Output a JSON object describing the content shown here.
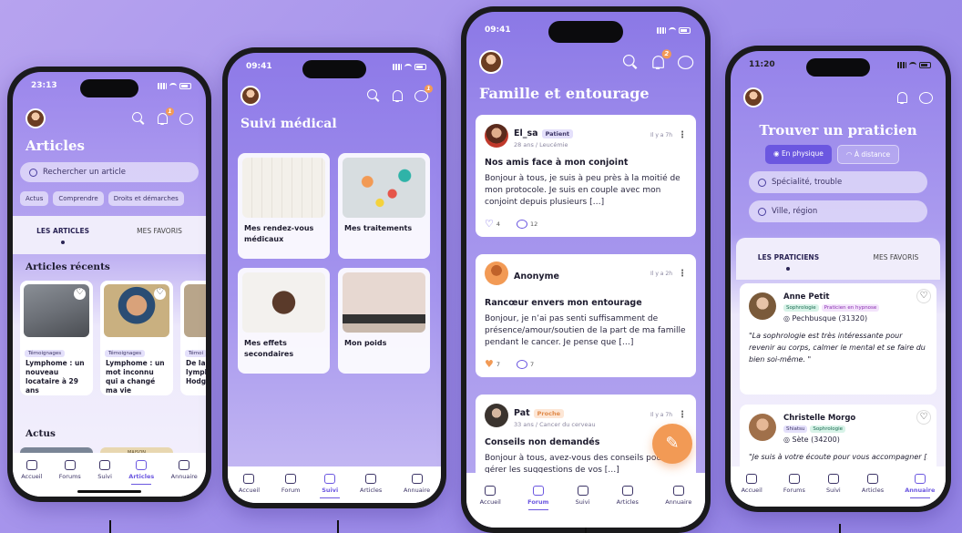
{
  "colors": {
    "accent": "#6b57e0",
    "orange": "#f29a55",
    "background": "#a695ec"
  },
  "phone1": {
    "time": "23:13",
    "notif_count": "1",
    "title": "Articles",
    "search_placeholder": "Rechercher un article",
    "chips": [
      "Actus",
      "Comprendre",
      "Droits et démarches"
    ],
    "tabs": [
      "LES ARTICLES",
      "MES FAVORIS"
    ],
    "recent_heading": "Articles récents",
    "articles": [
      {
        "tag": "Témoignages",
        "title": "Lymphome : un nouveau locataire à 29 ans"
      },
      {
        "tag": "Témoignages",
        "title": "Lymphome : un mot inconnu qui a changé ma vie"
      },
      {
        "tag": "Témoi",
        "title": "De la lymphome Hodgkin"
      }
    ],
    "actus_heading": "Actus",
    "actus_label": "MAISON"
  },
  "phone2": {
    "time": "09:41",
    "notif_count": "1",
    "title": "Suivi médical",
    "cards": [
      {
        "label": "Mes rendez-vous médicaux",
        "icon": "calendar-image"
      },
      {
        "label": "Mes traitements",
        "icon": "pills-image"
      },
      {
        "label": "Mes effets secondaires",
        "icon": "fatigue-image"
      },
      {
        "label": "Mon poids",
        "icon": "scale-image"
      }
    ]
  },
  "phone3": {
    "time": "09:41",
    "notif_count": "2",
    "title": "Famille et entourage",
    "posts": [
      {
        "author": "El_sa",
        "tag": "Patient",
        "sub": "28 ans / Leucémie",
        "time": "Il y a 7h",
        "title": "Nos amis face à mon conjoint",
        "body": "Bonjour à tous, je suis à peu près à la moitié de mon protocole. Je suis en couple avec mon conjoint depuis plusieurs […]",
        "likes": "4",
        "comments": "12"
      },
      {
        "author": "Anonyme",
        "tag": "",
        "sub": "",
        "time": "Il y a 2h",
        "title": "Rancœur envers mon entourage",
        "body": "Bonjour, je n’ai pas senti suffisamment de présence/amour/soutien de la part de ma famille pendant le cancer. Je pense que […]",
        "likes": "7",
        "comments": "7"
      },
      {
        "author": "Pat",
        "tag": "Proche",
        "sub": "33 ans / Cancer du cerveau",
        "time": "Il y a 7h",
        "title": "Conseils non demandés",
        "body": "Bonjour à tous, avez-vous des conseils pour gérer les suggestions de vos […]",
        "likes": "",
        "comments": ""
      }
    ]
  },
  "phone4": {
    "time": "11:20",
    "title": "Trouver un praticien",
    "segments": [
      "En physique",
      "À distance"
    ],
    "search1": "Spécialité, trouble",
    "search2": "Ville, région",
    "tabs": [
      "LES PRATICIENS",
      "MES FAVORIS"
    ],
    "practitioners": [
      {
        "name": "Anne Petit",
        "tags": [
          "Sophrologie",
          "Praticien en hypnose"
        ],
        "location": "Pechbusque (31320)",
        "quote": "\"La sophrologie est très intéressante pour revenir au corps, calmer le mental et se faire du bien soi-même. \""
      },
      {
        "name": "Christelle Morgo",
        "tags": [
          "Shiatsu",
          "Sophrologie"
        ],
        "location": "Sète (34200)",
        "quote": "\"Je suis à votre écoute pour vous accompagner […]\""
      }
    ]
  },
  "nav": {
    "accueil": "Accueil",
    "forums": "Forums",
    "forum": "Forum",
    "suivi": "Suivi",
    "articles": "Articles",
    "annuaire": "Annuaire"
  }
}
